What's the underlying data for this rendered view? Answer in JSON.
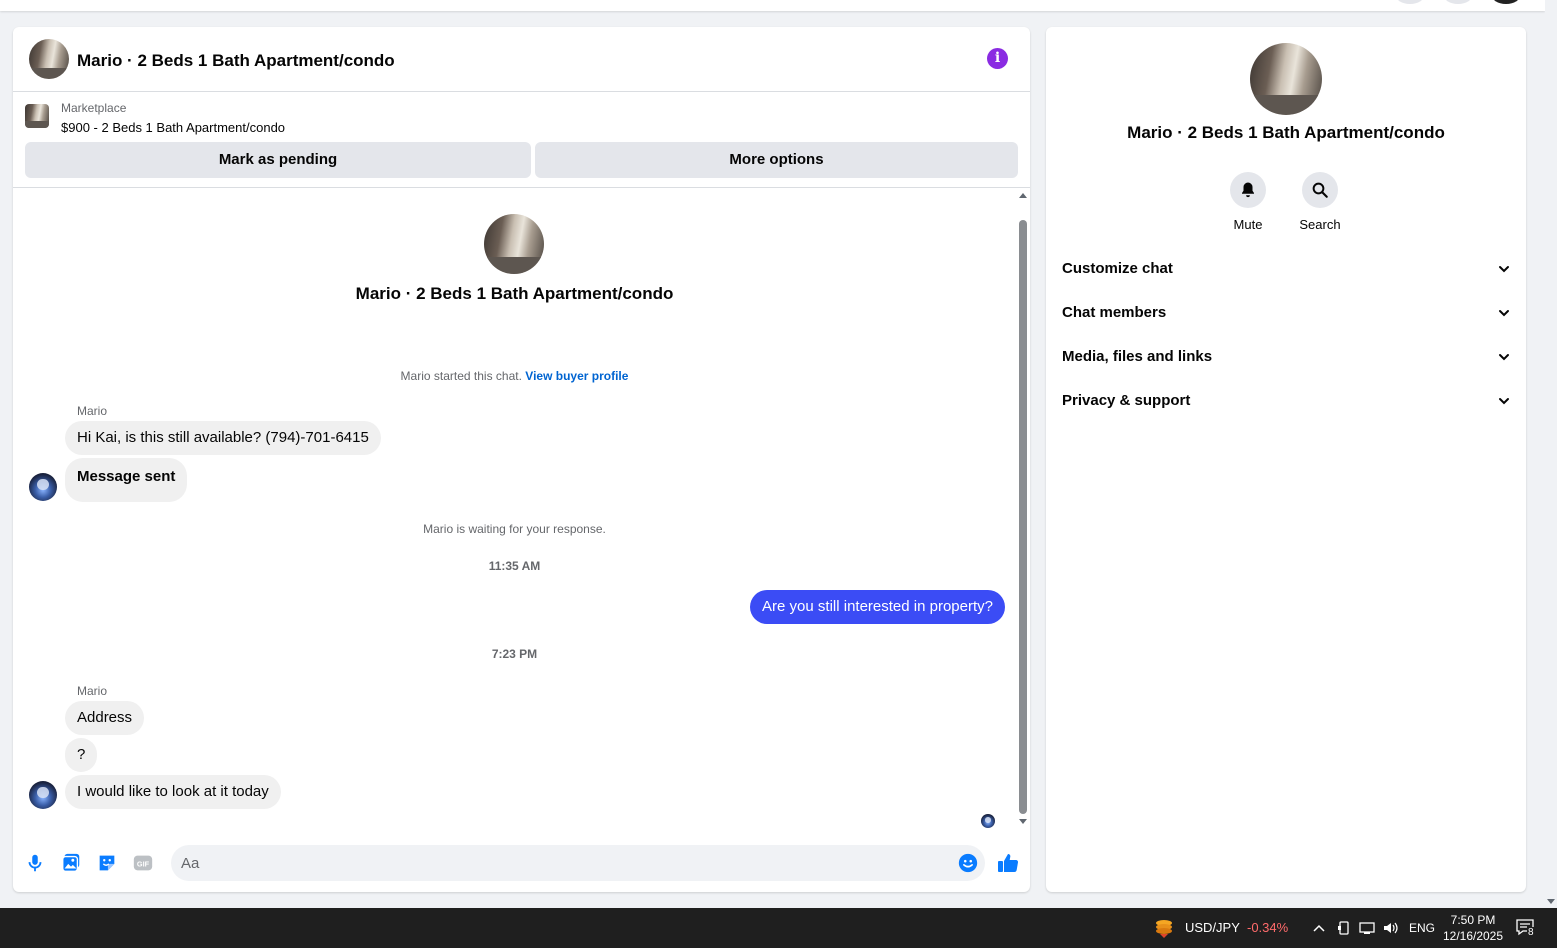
{
  "chat": {
    "title": "Mario · 2 Beds 1 Bath Apartment/condo",
    "marketplace_label": "Marketplace",
    "listing": "$900 - 2 Beds 1 Bath Apartment/condo",
    "mark_pending": "Mark as pending",
    "more_options": "More options"
  },
  "thread": {
    "title": "Mario · 2 Beds 1 Bath Apartment/condo",
    "started_text": "Mario started this chat.",
    "view_buyer_profile": "View buyer profile",
    "sender_1": "Mario",
    "msg_1": "Hi Kai, is this still available? (794)-701-6415",
    "msg_2": "Message sent",
    "waiting": "Mario is waiting for your response.",
    "time_1": "11:35 AM",
    "out_msg": "Are you still interested in property?",
    "time_2": "7:23 PM",
    "sender_2": "Mario",
    "msg_3": "Address",
    "msg_4": "?",
    "msg_5": "I would like to look at it today"
  },
  "composer": {
    "placeholder": "Aa",
    "icons": [
      "microphone-icon",
      "photo-icon",
      "sticker-icon",
      "gif-icon",
      "emoji-icon",
      "thumbs-up-icon"
    ]
  },
  "details": {
    "title": "Mario · 2 Beds 1 Bath Apartment/condo",
    "mute": "Mute",
    "search": "Search",
    "sections": [
      "Customize chat",
      "Chat members",
      "Media, files and links",
      "Privacy & support"
    ]
  },
  "taskbar": {
    "ticker": "USD/JPY",
    "change": "-0.34%",
    "lang": "ENG",
    "time": "7:50 PM",
    "date": "12/16/2025",
    "notifications": "8"
  },
  "colors": {
    "accent": "#3b4cf5",
    "info": "#8a2be2",
    "link": "#0064d1",
    "icon_blue": "#0a7cff",
    "negative": "#ff6b6b"
  }
}
